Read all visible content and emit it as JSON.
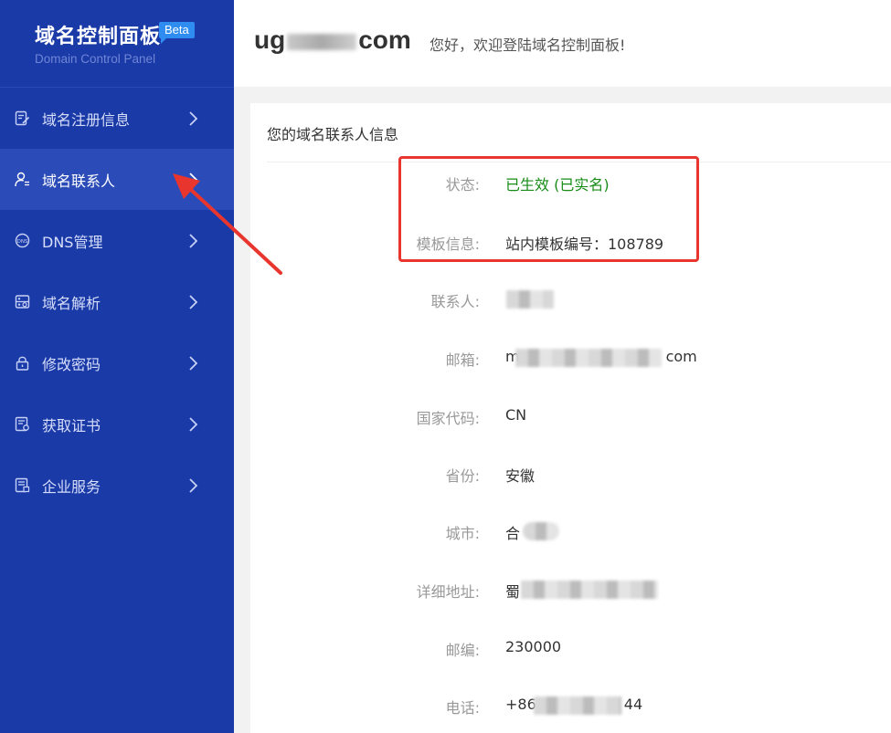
{
  "brand": {
    "title": "域名控制面板",
    "badge": "Beta",
    "subtitle": "Domain Control Panel"
  },
  "sidebar": {
    "items": [
      {
        "label": "域名注册信息",
        "icon": "edit-document-icon",
        "active": false
      },
      {
        "label": "域名联系人",
        "icon": "user-list-icon",
        "active": true
      },
      {
        "label": "DNS管理",
        "icon": "dns-globe-icon",
        "active": false
      },
      {
        "label": "域名解析",
        "icon": "server-icon",
        "active": false
      },
      {
        "label": "修改密码",
        "icon": "lock-icon",
        "active": false
      },
      {
        "label": "获取证书",
        "icon": "certificate-icon",
        "active": false
      },
      {
        "label": "企业服务",
        "icon": "enterprise-document-icon",
        "active": false
      }
    ]
  },
  "header": {
    "domain_prefix": "ug",
    "domain_suffix": "com",
    "welcome": "您好，欢迎登陆域名控制面板!"
  },
  "contact": {
    "title": "您的域名联系人信息",
    "fields": [
      {
        "label": "状态:",
        "value": "已生效 (已实名)"
      },
      {
        "label": "模板信息:",
        "value": "站内模板编号：108789"
      },
      {
        "label": "联系人:",
        "value": ""
      },
      {
        "label": "邮箱:",
        "value_prefix": "m",
        "value_suffix": "com"
      },
      {
        "label": "国家代码:",
        "value": "CN"
      },
      {
        "label": "省份:",
        "value": "安徽"
      },
      {
        "label": "城市:",
        "value": "合"
      },
      {
        "label": "详细地址:",
        "value": "蜀"
      },
      {
        "label": "邮编:",
        "value": "230000"
      },
      {
        "label": "电话:",
        "value_prefix": "+86",
        "value_suffix": "44"
      }
    ]
  },
  "colors": {
    "sidebar_bg": "#1a3aa8",
    "sidebar_active": "#2b4cb8",
    "status_green": "#168c16",
    "highlight_red": "#e8352d",
    "badge_blue": "#2f8cf0"
  }
}
